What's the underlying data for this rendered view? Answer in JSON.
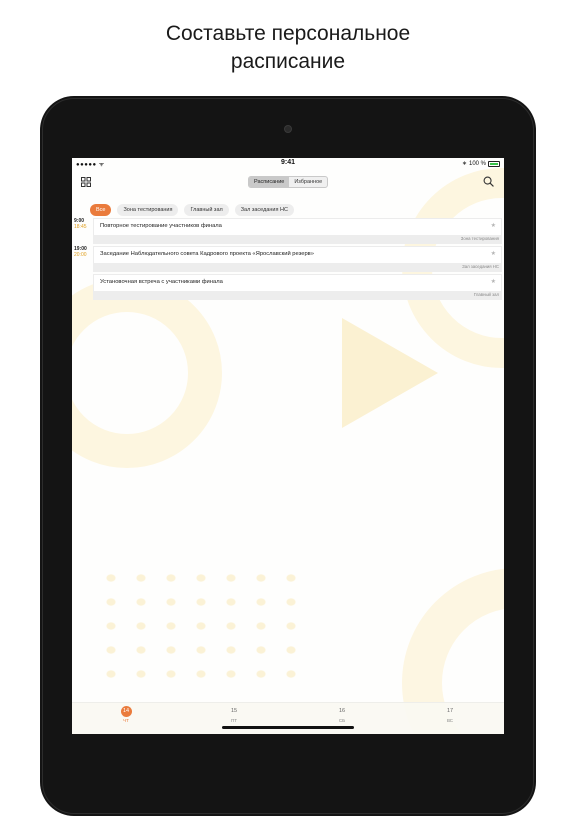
{
  "headline": {
    "line1": "Составьте персональное",
    "line2": "расписание"
  },
  "status_bar": {
    "signal": "●●●●●",
    "time": "9:41",
    "battery_text": "100 %",
    "bluetooth": "∗"
  },
  "nav": {
    "segments": [
      "Расписание",
      "Избранное"
    ],
    "active_segment": 0,
    "left_icon": "grid-icon",
    "right_icon": "search-icon"
  },
  "filters": [
    {
      "label": "Все",
      "active": true
    },
    {
      "label": "Зона тестирования",
      "active": false
    },
    {
      "label": "Главный зал",
      "active": false
    },
    {
      "label": "Зал заседания НС",
      "active": false
    }
  ],
  "events": [
    {
      "start": "9:00",
      "end": "18:45",
      "title": "Повторное тестирование участников финала",
      "place": "Зона тестирования"
    },
    {
      "start": "19:00",
      "end": "20:00",
      "title": "Заседание Наблюдательного совета Кадрового проекта «Ярославский резерв»",
      "place": "Зал заседания НС"
    },
    {
      "start": "",
      "end": "",
      "title": "Установочная встреча с участниками финала",
      "place": "Главный зал"
    }
  ],
  "days": [
    {
      "num": "14",
      "weekday": "ЧТ",
      "active": true
    },
    {
      "num": "15",
      "weekday": "ПТ",
      "active": false
    },
    {
      "num": "16",
      "weekday": "СБ",
      "active": false
    },
    {
      "num": "17",
      "weekday": "ВС",
      "active": false
    }
  ],
  "colors": {
    "accent": "#ea7b3c",
    "time_end": "#e0a020",
    "device": "#141414"
  }
}
